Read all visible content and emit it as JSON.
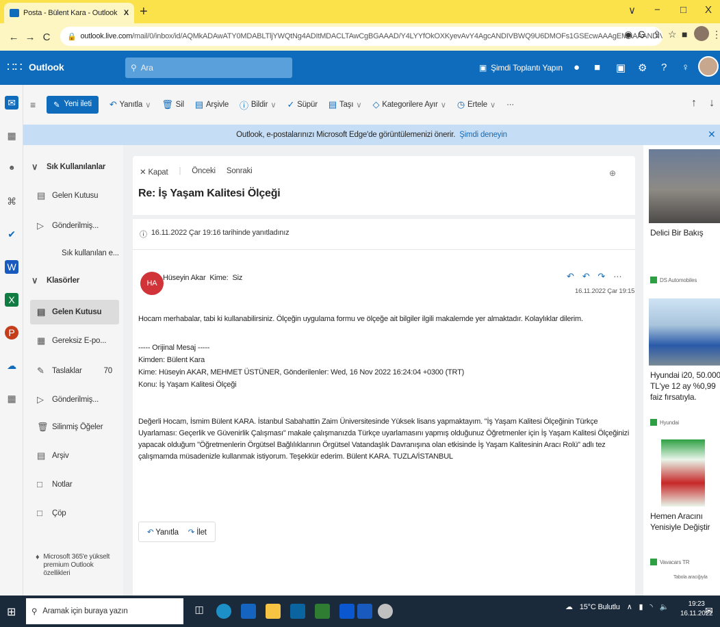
{
  "browser": {
    "tab_title": "Posta - Bülent Kara - Outlook",
    "tab_close": "X",
    "new_tab": "+",
    "window_controls": [
      "∨",
      "−",
      "□",
      "X"
    ],
    "nav": [
      "←",
      "→",
      "C"
    ],
    "url_domain": "outlook.live.com",
    "url_path": "/mail/0/inbox/id/AQMkADAwATY0MDABLTljYWQtNg4ADItMDACLTAwCgBGAAAD/Y4LYYfOkOXKyevAvY4AgcANDIVBWQ9U6DMOFs1GSEcwAAAgEMAAAANDIVBtWQ...",
    "icons": [
      "◉",
      "G",
      "⇪",
      "☆",
      "■",
      "⚙",
      "⋮"
    ]
  },
  "outlook": {
    "brand": "Outlook",
    "search_placeholder": "Ara",
    "meet_now": "Şimdi Toplantı Yapın",
    "header_icons": [
      "●",
      "■",
      "▣",
      "⚙",
      "?",
      "♀"
    ]
  },
  "commands": {
    "new_message": "Yeni ileti",
    "reply": "Yanıtla",
    "delete": "Sil",
    "archive": "Arşivle",
    "report": "Bildir",
    "sweep": "Süpür",
    "move": "Taşı",
    "categorize": "Kategorilere Ayır",
    "snooze": "Ertele",
    "more": "···"
  },
  "banner": {
    "text": "Outlook, e-postalarınızı Microsoft Edge'de görüntülemenizi önerir.",
    "link": "Şimdi deneyin"
  },
  "folders": {
    "favorites": "Sık Kullanılanlar",
    "fav_inbox": "Gelen Kutusu",
    "fav_sent": "Gönderilmiş...",
    "fav_more": "Sık kullanılan e...",
    "folders_header": "Klasörler",
    "inbox": "Gelen Kutusu",
    "junk": "Gereksiz E-po...",
    "drafts": "Taslaklar",
    "drafts_count": "70",
    "sent": "Gönderilmiş...",
    "deleted": "Silinmiş Öğeler",
    "archive": "Arşiv",
    "notes": "Notlar",
    "trash": "Çöp",
    "ms365": "Microsoft 365'e yükselt premium Outlook özellikleri"
  },
  "reading": {
    "close": "Kapat",
    "prev": "Önceki",
    "next": "Sonraki",
    "zoom": "⊕",
    "subject": "Re: İş Yaşam Kalitesi Ölçeği",
    "replied_note": "16.11.2022 Çar 19:16 tarihinde yanıtladınız",
    "avatar_initials": "HA",
    "sender": "Hüseyin Akar",
    "to_label": "Kime:",
    "to_value": "Siz",
    "date": "16.11.2022 Çar 19:15",
    "body_1": "Hocam merhabalar, tabi ki kullanabilirsiniz. Ölçeğin uygulama formu ve ölçeğe ait bilgiler ilgili makalemde yer almaktadır. Kolaylıklar dilerim.",
    "orig_header": "----- Orijinal Mesaj -----",
    "orig_from": "Kimden: Bülent Kara",
    "orig_to": "Kime: Hüseyin AKAR, MEHMET ÜSTÜNER, Gönderilenler: Wed, 16 Nov 2022 16:24:04 +0300 (TRT)",
    "orig_subject": "Konu: İş Yaşam Kalitesi Ölçeği",
    "orig_body": "Değerli Hocam, İsmim Bülent KARA. İstanbul Sabahattin Zaim Üniversitesinde Yüksek lisans yapmaktayım. \"İş Yaşam Kalitesi Ölçeğinin Türkçe Uyarlaması: Geçerlik ve Güvenirlik Çalışması\" makale çalışmanızda Türkçe uyarlamasını yapmış olduğunuz Öğretmenler için İş Yaşam Kalitesi Ölçeğinizi yapacak olduğum \"Öğretmenlerin Örgütsel Bağlılıklarının Örgütsel Vatandaşlık Davranışına olan etkisinde İş Yaşam Kalitesinin Aracı Rolü\" adlı tez çalışmamda müsadenizle kullanmak istiyorum. Teşekkür ederim. Bülent KARA. TUZLA/İSTANBUL",
    "reply_btn": "Yanıtla",
    "forward_btn": "İlet"
  },
  "ads": {
    "ad1_title": "Delici Bir Bakış",
    "ad1_source": "DS Automobiles",
    "ad2_title": "Hyundai i20, 50.000 TL'ye 12 ay %0,99 faiz fırsatıyla.",
    "ad2_source": "Hyundai",
    "ad3_title": "Hemen Aracını Yenisiyle Değiştir",
    "ad3_source": "Vavacars TR",
    "ad_choices": "Tabola aracığıyla"
  },
  "taskbar": {
    "search_placeholder": "Aramak için buraya yazın",
    "weather": "15°C Bulutlu",
    "time": "19:23",
    "date": "16.11.2022"
  }
}
